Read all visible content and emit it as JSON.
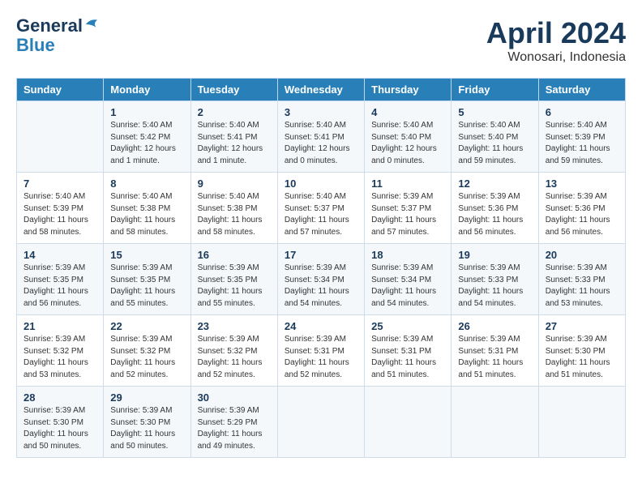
{
  "header": {
    "logo_line1": "General",
    "logo_line2": "Blue",
    "month_title": "April 2024",
    "location": "Wonosari, Indonesia"
  },
  "weekdays": [
    "Sunday",
    "Monday",
    "Tuesday",
    "Wednesday",
    "Thursday",
    "Friday",
    "Saturday"
  ],
  "weeks": [
    [
      {
        "day": "",
        "info": ""
      },
      {
        "day": "1",
        "info": "Sunrise: 5:40 AM\nSunset: 5:42 PM\nDaylight: 12 hours\nand 1 minute."
      },
      {
        "day": "2",
        "info": "Sunrise: 5:40 AM\nSunset: 5:41 PM\nDaylight: 12 hours\nand 1 minute."
      },
      {
        "day": "3",
        "info": "Sunrise: 5:40 AM\nSunset: 5:41 PM\nDaylight: 12 hours\nand 0 minutes."
      },
      {
        "day": "4",
        "info": "Sunrise: 5:40 AM\nSunset: 5:40 PM\nDaylight: 12 hours\nand 0 minutes."
      },
      {
        "day": "5",
        "info": "Sunrise: 5:40 AM\nSunset: 5:40 PM\nDaylight: 11 hours\nand 59 minutes."
      },
      {
        "day": "6",
        "info": "Sunrise: 5:40 AM\nSunset: 5:39 PM\nDaylight: 11 hours\nand 59 minutes."
      }
    ],
    [
      {
        "day": "7",
        "info": "Sunrise: 5:40 AM\nSunset: 5:39 PM\nDaylight: 11 hours\nand 58 minutes."
      },
      {
        "day": "8",
        "info": "Sunrise: 5:40 AM\nSunset: 5:38 PM\nDaylight: 11 hours\nand 58 minutes."
      },
      {
        "day": "9",
        "info": "Sunrise: 5:40 AM\nSunset: 5:38 PM\nDaylight: 11 hours\nand 58 minutes."
      },
      {
        "day": "10",
        "info": "Sunrise: 5:40 AM\nSunset: 5:37 PM\nDaylight: 11 hours\nand 57 minutes."
      },
      {
        "day": "11",
        "info": "Sunrise: 5:39 AM\nSunset: 5:37 PM\nDaylight: 11 hours\nand 57 minutes."
      },
      {
        "day": "12",
        "info": "Sunrise: 5:39 AM\nSunset: 5:36 PM\nDaylight: 11 hours\nand 56 minutes."
      },
      {
        "day": "13",
        "info": "Sunrise: 5:39 AM\nSunset: 5:36 PM\nDaylight: 11 hours\nand 56 minutes."
      }
    ],
    [
      {
        "day": "14",
        "info": "Sunrise: 5:39 AM\nSunset: 5:35 PM\nDaylight: 11 hours\nand 56 minutes."
      },
      {
        "day": "15",
        "info": "Sunrise: 5:39 AM\nSunset: 5:35 PM\nDaylight: 11 hours\nand 55 minutes."
      },
      {
        "day": "16",
        "info": "Sunrise: 5:39 AM\nSunset: 5:35 PM\nDaylight: 11 hours\nand 55 minutes."
      },
      {
        "day": "17",
        "info": "Sunrise: 5:39 AM\nSunset: 5:34 PM\nDaylight: 11 hours\nand 54 minutes."
      },
      {
        "day": "18",
        "info": "Sunrise: 5:39 AM\nSunset: 5:34 PM\nDaylight: 11 hours\nand 54 minutes."
      },
      {
        "day": "19",
        "info": "Sunrise: 5:39 AM\nSunset: 5:33 PM\nDaylight: 11 hours\nand 54 minutes."
      },
      {
        "day": "20",
        "info": "Sunrise: 5:39 AM\nSunset: 5:33 PM\nDaylight: 11 hours\nand 53 minutes."
      }
    ],
    [
      {
        "day": "21",
        "info": "Sunrise: 5:39 AM\nSunset: 5:32 PM\nDaylight: 11 hours\nand 53 minutes."
      },
      {
        "day": "22",
        "info": "Sunrise: 5:39 AM\nSunset: 5:32 PM\nDaylight: 11 hours\nand 52 minutes."
      },
      {
        "day": "23",
        "info": "Sunrise: 5:39 AM\nSunset: 5:32 PM\nDaylight: 11 hours\nand 52 minutes."
      },
      {
        "day": "24",
        "info": "Sunrise: 5:39 AM\nSunset: 5:31 PM\nDaylight: 11 hours\nand 52 minutes."
      },
      {
        "day": "25",
        "info": "Sunrise: 5:39 AM\nSunset: 5:31 PM\nDaylight: 11 hours\nand 51 minutes."
      },
      {
        "day": "26",
        "info": "Sunrise: 5:39 AM\nSunset: 5:31 PM\nDaylight: 11 hours\nand 51 minutes."
      },
      {
        "day": "27",
        "info": "Sunrise: 5:39 AM\nSunset: 5:30 PM\nDaylight: 11 hours\nand 51 minutes."
      }
    ],
    [
      {
        "day": "28",
        "info": "Sunrise: 5:39 AM\nSunset: 5:30 PM\nDaylight: 11 hours\nand 50 minutes."
      },
      {
        "day": "29",
        "info": "Sunrise: 5:39 AM\nSunset: 5:30 PM\nDaylight: 11 hours\nand 50 minutes."
      },
      {
        "day": "30",
        "info": "Sunrise: 5:39 AM\nSunset: 5:29 PM\nDaylight: 11 hours\nand 49 minutes."
      },
      {
        "day": "",
        "info": ""
      },
      {
        "day": "",
        "info": ""
      },
      {
        "day": "",
        "info": ""
      },
      {
        "day": "",
        "info": ""
      }
    ]
  ]
}
